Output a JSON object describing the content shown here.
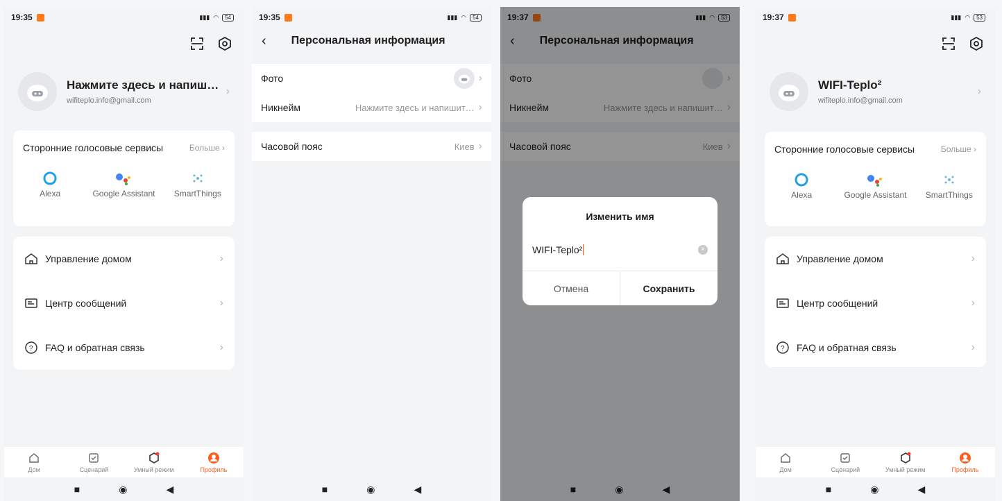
{
  "status": {
    "s1": {
      "time": "19:35",
      "battery": "54"
    },
    "s2": {
      "time": "19:35",
      "battery": "54"
    },
    "s3": {
      "time": "19:37",
      "battery": "53"
    },
    "s4": {
      "time": "19:37",
      "battery": "53"
    }
  },
  "profile": {
    "s1": {
      "name": "Нажмите здесь и напиш…",
      "email": "wifiteplo.info@gmail.com"
    },
    "s4": {
      "name": "WIFI-Teplo²",
      "email": "wifiteplo.info@gmail.com"
    }
  },
  "voice": {
    "title": "Сторонние голосовые сервисы",
    "more": "Больше",
    "items": [
      {
        "label": "Alexa",
        "icon": "alexa-icon"
      },
      {
        "label": "Google Assistant",
        "icon": "google-assistant-icon"
      },
      {
        "label": "SmartThings",
        "icon": "smartthings-icon"
      }
    ]
  },
  "menu": [
    {
      "label": "Управление домом",
      "icon": "home-icon"
    },
    {
      "label": "Центр сообщений",
      "icon": "message-icon"
    },
    {
      "label": "FAQ и обратная связь",
      "icon": "help-icon"
    }
  ],
  "tabs": [
    {
      "label": "Дом",
      "icon": "home-tab-icon"
    },
    {
      "label": "Сценарий",
      "icon": "scenario-icon"
    },
    {
      "label": "Умный режим",
      "icon": "smart-icon"
    },
    {
      "label": "Профиль",
      "icon": "profile-icon"
    }
  ],
  "personal": {
    "title": "Персональная информация",
    "photo_label": "Фото",
    "nickname_label": "Никнейм",
    "nickname_value": "Нажмите здесь и напишит…",
    "timezone_label": "Часовой пояс",
    "timezone_value": "Киев"
  },
  "dialog": {
    "title": "Изменить имя",
    "value": "WIFI-Teplo²",
    "cancel": "Отмена",
    "save": "Сохранить"
  },
  "colors": {
    "accent": "#ff5b1a",
    "background": "#f3f4f6"
  }
}
